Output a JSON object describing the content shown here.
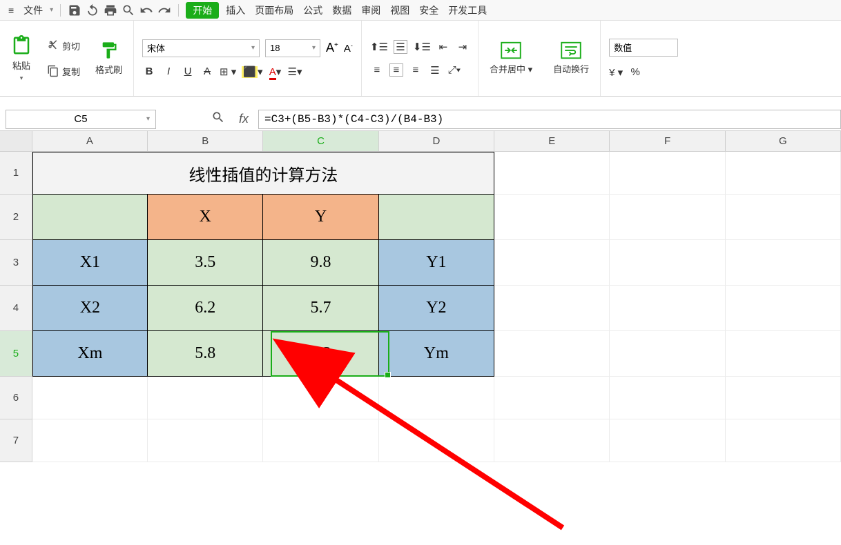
{
  "menubar": {
    "file": "文件",
    "tabs": [
      "开始",
      "插入",
      "页面布局",
      "公式",
      "数据",
      "审阅",
      "视图",
      "安全",
      "开发工具"
    ]
  },
  "ribbon": {
    "paste": "粘贴",
    "cut": "剪切",
    "copy": "复制",
    "format_painter": "格式刷",
    "font_name": "宋体",
    "font_size": "18",
    "merge": "合并居中",
    "wrap": "自动换行",
    "number_format": "数值"
  },
  "formula": {
    "cell_ref": "C5",
    "text": "=C3+(B5-B3)*(C4-C3)/(B4-B3)"
  },
  "columns": [
    "A",
    "B",
    "C",
    "D",
    "E",
    "F",
    "G"
  ],
  "rows": [
    "1",
    "2",
    "3",
    "4",
    "5",
    "6",
    "7"
  ],
  "table": {
    "title": "线性插值的计算方法",
    "h_x": "X",
    "h_y": "Y",
    "r3": {
      "a": "X1",
      "b": "3.5",
      "c": "9.8",
      "d": "Y1"
    },
    "r4": {
      "a": "X2",
      "b": "6.2",
      "c": "5.7",
      "d": "Y2"
    },
    "r5": {
      "a": "Xm",
      "b": "5.8",
      "c": "6.3",
      "d": "Ym"
    }
  }
}
